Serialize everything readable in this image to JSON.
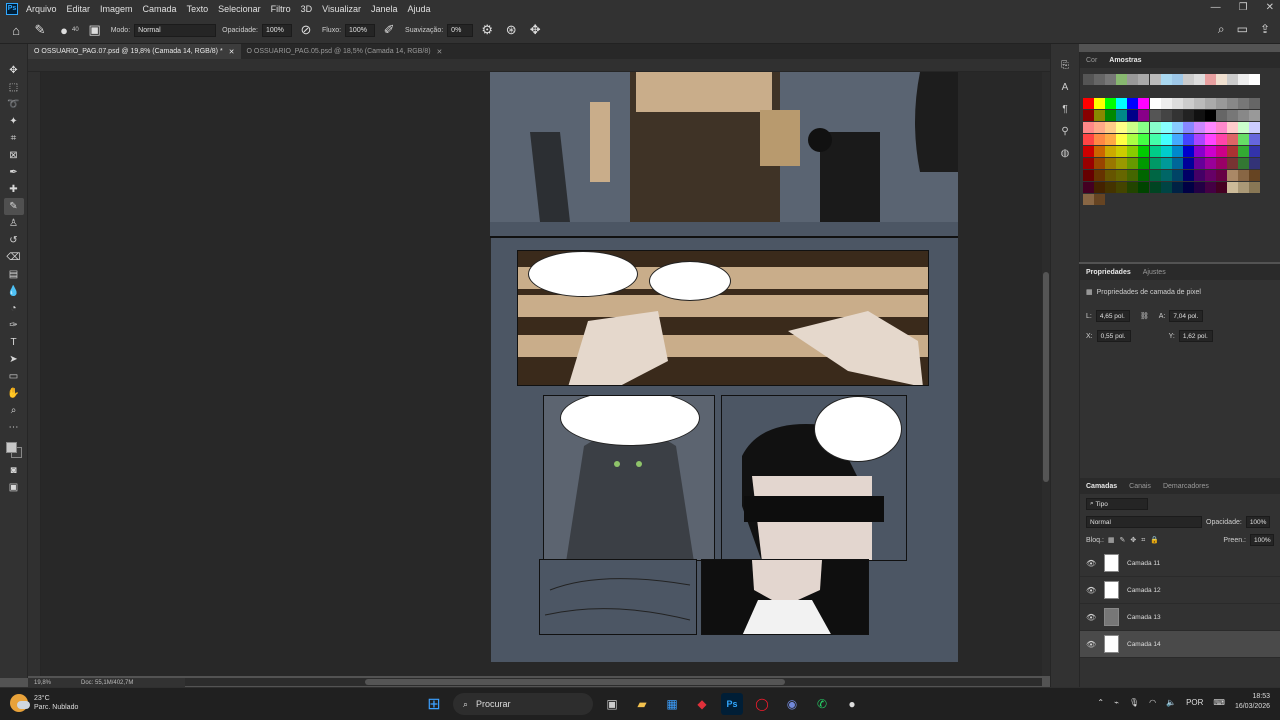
{
  "menu": [
    "Arquivo",
    "Editar",
    "Imagem",
    "Camada",
    "Texto",
    "Selecionar",
    "Filtro",
    "3D",
    "Visualizar",
    "Janela",
    "Ajuda"
  ],
  "options": {
    "brush_size": "40",
    "mode_label": "Modo:",
    "mode_value": "Normal",
    "opacity_label": "Opacidade:",
    "opacity_value": "100%",
    "flow_label": "Fluxo:",
    "flow_value": "100%",
    "smoothing_label": "Suavização:",
    "smoothing_value": "0%"
  },
  "tabs": [
    {
      "label": "O OSSUARIO_PAG.07.psd @ 19,8% (Camada 14, RGB/8) *",
      "active": true
    },
    {
      "label": "O OSSUARIO_PAG.05.psd @ 18,5% (Camada 14, RGB/8)",
      "active": false
    }
  ],
  "status": {
    "zoom": "19,8%",
    "doc": "Doc: 55,1M/402,7M"
  },
  "color_panel": {
    "tabs": [
      "Cor",
      "Amostras"
    ],
    "active": "Amostras"
  },
  "properties_panel": {
    "tabs": [
      "Propriedades",
      "Ajustes"
    ],
    "active": "Propriedades",
    "title": "Propriedades de camada de pixel",
    "w_label": "L:",
    "w_value": "4,65 pol.",
    "h_label": "A:",
    "h_value": "7,04 pol.",
    "x_label": "X:",
    "x_value": "0,55 pol.",
    "y_label": "Y:",
    "y_value": "1,62 pol."
  },
  "layers_panel": {
    "tabs": [
      "Camadas",
      "Canais",
      "Demarcadores"
    ],
    "active": "Camadas",
    "filter": "Tipo",
    "blend": "Normal",
    "opacity_label": "Opacidade:",
    "opacity_value": "100%",
    "lock_label": "Bloq.:",
    "fill_label": "Preen.:",
    "fill_value": "100%",
    "layers": [
      {
        "name": "Camada 11",
        "selected": false
      },
      {
        "name": "Camada 12",
        "selected": false
      },
      {
        "name": "Camada 13",
        "selected": false
      },
      {
        "name": "Camada 14",
        "selected": true
      }
    ]
  },
  "taskbar": {
    "temp": "23°C",
    "weather": "Parc. Nublado",
    "search": "Procurar",
    "lang": "POR",
    "time": "18:53",
    "date": "16/03/2026"
  },
  "colors": {
    "accent": "#31a8ff",
    "ui_dark": "#323232",
    "canvas_bg": "#282828",
    "page_bg": "#4c5664"
  }
}
